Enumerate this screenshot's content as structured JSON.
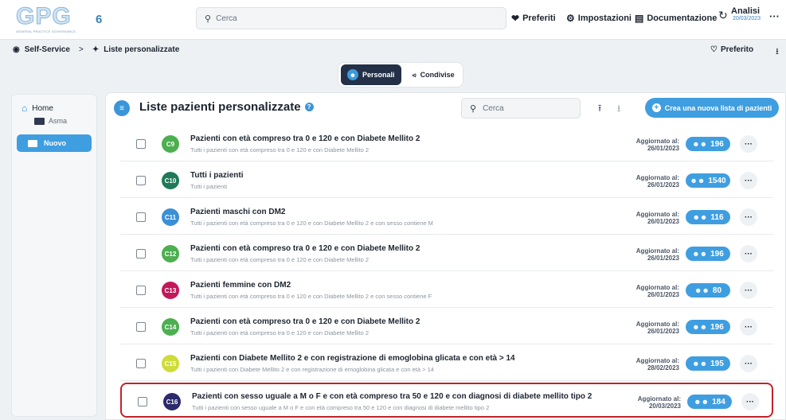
{
  "logo": {
    "text": "GPG",
    "subtext": "GENERAL PRACTICE GOVERNANCE",
    "version": "6"
  },
  "header": {
    "search_placeholder": "Cerca",
    "preferiti": "Preferiti",
    "impostazioni": "Impostazioni",
    "documentazione": "Documentazione",
    "analisi": "Analisi",
    "analisi_date": "20/03/2023",
    "more": "···"
  },
  "breadcrumb": {
    "root": "Self-Service",
    "separator": ">",
    "current": "Liste personalizzate"
  },
  "actions": {
    "preferito": "Preferito"
  },
  "tabs": {
    "personali": "Personali",
    "condivise": "Condivise"
  },
  "sidebar": {
    "home": "Home",
    "asma": "Asma",
    "nuovo": "Nuovo"
  },
  "panel": {
    "title": "Liste pazienti personalizzate",
    "search_placeholder": "Cerca",
    "create_label": "Crea una nuova lista di pazienti"
  },
  "updated_label": "Aggiornato al:",
  "rows": [
    {
      "code": "C9",
      "color": "#4caf50",
      "title": "Pazienti con età compreso tra 0 e 120 e con Diabete Mellito 2",
      "desc": "Tutti i pazienti con età compreso tra 0 e 120 e con Diabete Mellito 2",
      "date": "26/01/2023",
      "count": "196"
    },
    {
      "code": "C10",
      "color": "#1f7a5a",
      "title": "Tutti i pazienti",
      "desc": "Tutti i pazienti",
      "date": "26/01/2023",
      "count": "1540"
    },
    {
      "code": "C11",
      "color": "#3b8fd6",
      "title": "Pazienti maschi con DM2",
      "desc": "Tutti i pazienti con età compreso tra 0 e 120 e con Diabete Mellito 2 e con sesso contiene M",
      "date": "26/01/2023",
      "count": "116"
    },
    {
      "code": "C12",
      "color": "#4caf50",
      "title": "Pazienti con età compreso tra 0 e 120 e con Diabete Mellito 2",
      "desc": "Tutti i pazienti con età compreso tra 0 e 120 e con Diabete Mellito 2",
      "date": "26/01/2023",
      "count": "196"
    },
    {
      "code": "C13",
      "color": "#c2185b",
      "title": "Pazienti femmine con DM2",
      "desc": "Tutti i pazienti con età compreso tra 0 e 120 e con Diabete Mellito 2 e con sesso contiene F",
      "date": "26/01/2023",
      "count": "80"
    },
    {
      "code": "C14",
      "color": "#4caf50",
      "title": "Pazienti con età compreso tra 0 e 120 e con Diabete Mellito 2",
      "desc": "Tutti i pazienti con età compreso tra 0 e 120 e con Diabete Mellito 2",
      "date": "26/01/2023",
      "count": "196"
    },
    {
      "code": "C15",
      "color": "#cddc39",
      "title": "Pazienti con Diabete Mellito 2 e con registrazione di emoglobina glicata e con età > 14",
      "desc": "Tutti i pazienti con Diabete Mellito 2 e con registrazione di emoglobina glicata e con età > 14",
      "date": "28/02/2023",
      "count": "195"
    },
    {
      "code": "C16",
      "color": "#2b2a6b",
      "title": "Pazienti con sesso uguale a M o F e con età compreso tra 50 e 120 e con diagnosi di diabete mellito tipo 2",
      "desc": "Tutti i pazienti con sesso uguale a M o F e con età compreso tra 50 e 120 e con diagnosi di diabete mellito tipo 2",
      "date": "20/03/2023",
      "count": "184",
      "highlight": true
    }
  ]
}
